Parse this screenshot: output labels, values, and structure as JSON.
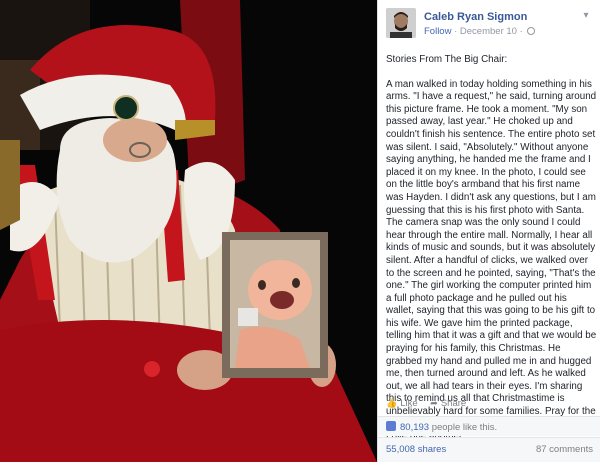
{
  "post": {
    "author": "Caleb Ryan Sigmon",
    "follow_label": "Follow",
    "date": "December 10",
    "separator": "·",
    "body_heading": "Stories From The Big Chair:",
    "body_text": "A man walked in today holding something in his arms. \"I have a request,\" he said, turning around this picture frame. He took a moment. \"My son passed away, last year.\" He choked up and couldn't finish his sentence. The entire photo set was silent. I said, \"Absolutely.\" Without anyone saying anything, he handed me the frame and I placed it on my knee. In the photo, I could see on the little boy's armband that his first name was Hayden. I didn't ask any questions, but I am guessing that this is his first photo with Santa. The camera snap was the only sound I could hear through the entire mall. Normally, I hear all kinds of music and sounds, but it was absolutely silent. After a handful of clicks, we walked over to the screen and he pointed, saying, \"That's the one.\" The girl working the computer printed him a full photo package and he pulled out his wallet, saying that this was going to be his gift to his wife. We gave him the printed package, telling him that it was a gift and that we would be praying for his family, this Christmas. He grabbed my hand and pulled me in and hugged me, then turned around and left. As he walked out, we all had tears in their eyes. I'm sharing this to remind us all that Christmastime is unbelievably hard for some families. Pray for the brokenhearted. Smile at people. Just be kind. Love one another."
  },
  "actions": {
    "like_label": "Like",
    "share_label": "Share"
  },
  "stats": {
    "likes_count": "80,193",
    "likes_suffix": "people like this.",
    "shares": "55,008 shares",
    "comments": "87 comments"
  },
  "colors": {
    "link_blue": "#3b5998",
    "text": "#1d2129",
    "muted": "#9197a3",
    "santa_red": "#b3121b"
  }
}
